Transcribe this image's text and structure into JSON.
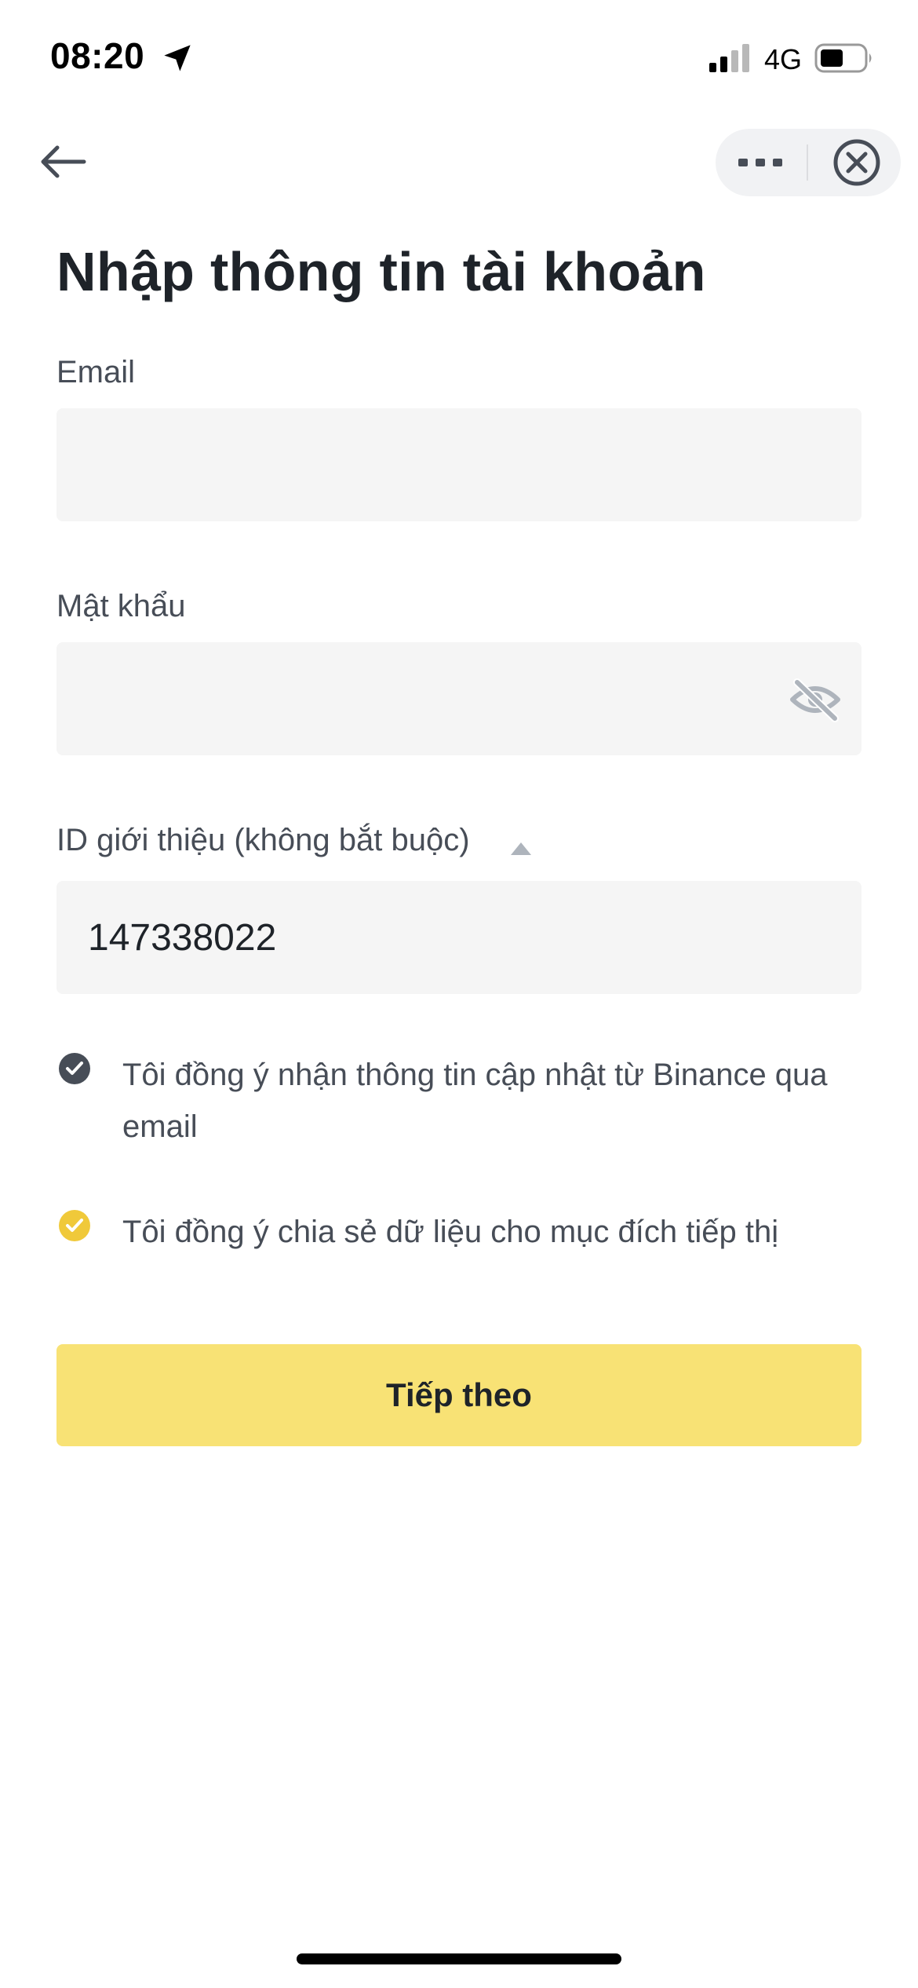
{
  "status_bar": {
    "time": "08:20",
    "network": "4G",
    "icons": [
      "location-arrow-icon",
      "cellular-signal-icon",
      "battery-icon"
    ]
  },
  "nav": {
    "icons": [
      "back-arrow-icon",
      "more-dots-icon",
      "close-circle-icon"
    ]
  },
  "title": "Nhập thông tin tài khoản",
  "form": {
    "email": {
      "label": "Email",
      "value": "",
      "placeholder": ""
    },
    "password": {
      "label": "Mật khẩu",
      "value": "",
      "placeholder": "",
      "icon": "eye-off-icon"
    },
    "referral": {
      "label": "ID giới thiệu (không bắt buộc)",
      "value": "147338022",
      "icon": "caret-up-icon"
    }
  },
  "consents": [
    {
      "text": "Tôi đồng ý nhận thông tin cập nhật từ Binance qua email",
      "checked": true,
      "icon": "check-circle-dark-icon"
    },
    {
      "text": "Tôi đồng ý chia sẻ dữ liệu cho mục đích tiếp thị",
      "checked": true,
      "icon": "check-circle-yellow-icon"
    }
  ],
  "next_button": {
    "label": "Tiếp theo"
  },
  "colors": {
    "accent": "#f8e275",
    "field_bg": "#f5f5f5",
    "text_primary": "#1e2329",
    "text_secondary": "#474d57",
    "check_dark": "#474d57",
    "check_yellow": "#f0c93a"
  }
}
